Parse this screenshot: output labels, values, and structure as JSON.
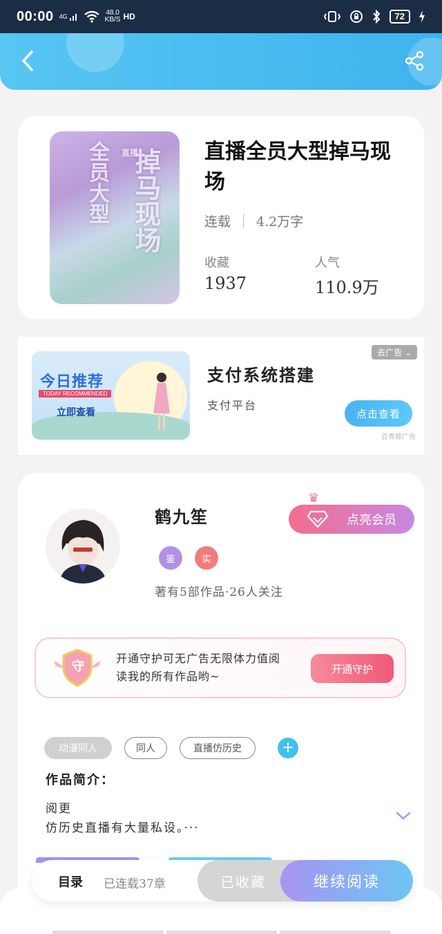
{
  "status_bar": {
    "time": "00:00",
    "network": "4G",
    "speed_value": "48.0",
    "speed_unit": "KB/S",
    "hd": "HD",
    "battery": "72"
  },
  "header": {
    "back_icon": "chevron-left-icon",
    "share_icon": "share-icon"
  },
  "book": {
    "cover_title_1": "全员大型",
    "cover_title_2": "掉马现场",
    "cover_small": "直播",
    "title": "直播全员大型掉马现场",
    "status": "连载",
    "word_count": "4.2万字",
    "favorites_label": "收藏",
    "favorites_value": "1937",
    "popularity_label": "人气",
    "popularity_value": "110.9万"
  },
  "ad": {
    "image_title": "今日推荐",
    "image_subtitle": "TODAY RECOMMENDED",
    "image_cta": "立即查看",
    "remove_label": "去广告",
    "title": "支付系统搭建",
    "subtitle": "支付平台",
    "button": "点击查看",
    "source": "百青藤广告"
  },
  "author": {
    "name": "鹤九笙",
    "badge_1": "鉴",
    "badge_2": "实",
    "works_info": "著有5部作品·26人关注",
    "vip_button": "点亮会员",
    "guard_text": "开通守护可无广告无限体力值阅读我的所有作品哟~",
    "guard_icon_label": "守",
    "guard_button": "开通守护",
    "tags": [
      "动漫同人",
      "同人",
      "直播仿历史"
    ],
    "intro_heading": "作品简介：",
    "intro_line_1": "阅更",
    "intro_line_2": "仿历史直播有大量私设。···"
  },
  "bottom_bar": {
    "toc": "目录",
    "updated": "已连载37章",
    "favorited": "已收藏",
    "continue": "继续阅读"
  },
  "colors": {
    "header": "#4fbdf1",
    "accent_blue": "#40bff0",
    "vip_pink": "#f56d8c",
    "vip_purple": "#c788e3"
  }
}
